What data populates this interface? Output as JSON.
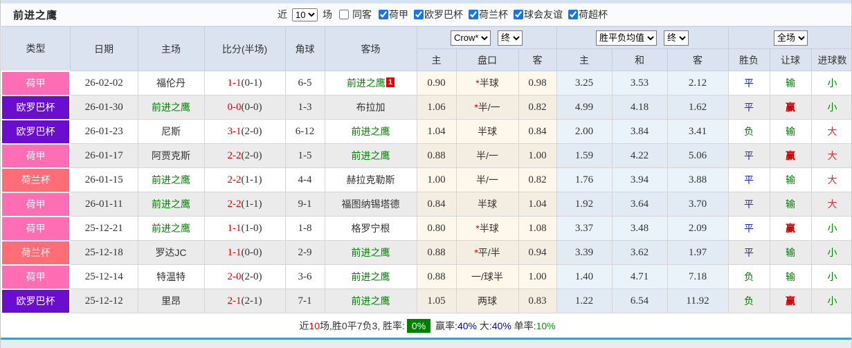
{
  "title": "前进之鹰",
  "filter_bar": {
    "recent_label": "近",
    "recent_value": "10",
    "games_label": "场",
    "same_away": {
      "label": "同客",
      "checked": false
    },
    "competitions": [
      {
        "label": "荷甲",
        "checked": true
      },
      {
        "label": "欧罗巴杯",
        "checked": true
      },
      {
        "label": "荷兰杯",
        "checked": true
      },
      {
        "label": "球会友谊",
        "checked": true
      },
      {
        "label": "荷超杯",
        "checked": true
      }
    ]
  },
  "table": {
    "static_headers": [
      "类型",
      "日期",
      "主场",
      "比分(半场)",
      "角球",
      "客场"
    ],
    "selects": {
      "odds_company": "Crow*",
      "odds_time_1": "终",
      "avg_type": "胜平负均值",
      "odds_time_2": "终",
      "scope": "全场"
    },
    "sub_headers": [
      "主",
      "盘口",
      "客",
      "主",
      "和",
      "客",
      "胜负",
      "让球",
      "进球数"
    ],
    "rows": [
      {
        "comp": "荷甲",
        "date": "26-02-02",
        "home": "福伦丹",
        "home_team": false,
        "score": "1-1",
        "half": "(0-1)",
        "corners": "6-5",
        "away": "前进之鹰",
        "away_team": true,
        "away_badge": "1",
        "odds_home": "0.90",
        "hcap_star": true,
        "handicap": "半球",
        "odds_away": "0.98",
        "avg_home": "3.25",
        "avg_draw": "3.53",
        "avg_away": "2.12",
        "result": "平",
        "hcap_result": "输",
        "goal_result": "小"
      },
      {
        "comp": "欧罗巴杯",
        "date": "26-01-30",
        "home": "前进之鹰",
        "home_team": true,
        "score": "0-0",
        "half": "(0-0)",
        "corners": "1-3",
        "away": "布拉加",
        "away_team": false,
        "away_badge": "",
        "odds_home": "1.06",
        "hcap_star": true,
        "handicap": "半/一",
        "odds_away": "0.82",
        "avg_home": "4.99",
        "avg_draw": "4.18",
        "avg_away": "1.62",
        "result": "平",
        "hcap_result": "赢",
        "goal_result": "小"
      },
      {
        "comp": "欧罗巴杯",
        "date": "26-01-23",
        "home": "尼斯",
        "home_team": false,
        "score": "3-1",
        "half": "(2-0)",
        "corners": "6-12",
        "away": "前进之鹰",
        "away_team": true,
        "away_badge": "",
        "odds_home": "1.04",
        "hcap_star": false,
        "handicap": "半球",
        "odds_away": "0.84",
        "avg_home": "2.00",
        "avg_draw": "3.84",
        "avg_away": "3.41",
        "result": "负",
        "hcap_result": "输",
        "goal_result": "大"
      },
      {
        "comp": "荷甲",
        "date": "26-01-17",
        "home": "阿贾克斯",
        "home_team": false,
        "score": "2-2",
        "half": "(2-0)",
        "corners": "1-5",
        "away": "前进之鹰",
        "away_team": true,
        "away_badge": "",
        "odds_home": "0.88",
        "hcap_star": false,
        "handicap": "半/一",
        "odds_away": "1.00",
        "avg_home": "1.59",
        "avg_draw": "4.22",
        "avg_away": "5.06",
        "result": "平",
        "hcap_result": "赢",
        "goal_result": "大"
      },
      {
        "comp": "荷兰杯",
        "date": "26-01-15",
        "home": "前进之鹰",
        "home_team": true,
        "score": "2-2",
        "half": "(1-1)",
        "corners": "4-4",
        "away": "赫拉克勒斯",
        "away_team": false,
        "away_badge": "",
        "odds_home": "1.00",
        "hcap_star": false,
        "handicap": "半/一",
        "odds_away": "0.82",
        "avg_home": "1.76",
        "avg_draw": "3.94",
        "avg_away": "3.88",
        "result": "平",
        "hcap_result": "输",
        "goal_result": "大"
      },
      {
        "comp": "荷甲",
        "date": "26-01-11",
        "home": "前进之鹰",
        "home_team": true,
        "score": "2-2",
        "half": "(1-1)",
        "corners": "9-1",
        "away": "福图纳锡塔德",
        "away_team": false,
        "away_badge": "",
        "odds_home": "0.84",
        "hcap_star": false,
        "handicap": "半球",
        "odds_away": "1.04",
        "avg_home": "1.92",
        "avg_draw": "3.64",
        "avg_away": "3.70",
        "result": "平",
        "hcap_result": "输",
        "goal_result": "大"
      },
      {
        "comp": "荷甲",
        "date": "25-12-21",
        "home": "前进之鹰",
        "home_team": true,
        "score": "1-1",
        "half": "(1-0)",
        "corners": "1-8",
        "away": "格罗宁根",
        "away_team": false,
        "away_badge": "",
        "odds_home": "0.80",
        "hcap_star": true,
        "handicap": "半球",
        "odds_away": "1.08",
        "avg_home": "3.37",
        "avg_draw": "3.48",
        "avg_away": "2.09",
        "result": "平",
        "hcap_result": "赢",
        "goal_result": "小"
      },
      {
        "comp": "荷兰杯",
        "date": "25-12-18",
        "home": "罗达JC",
        "home_team": false,
        "score": "1-1",
        "half": "(0-0)",
        "corners": "2-9",
        "away": "前进之鹰",
        "away_team": true,
        "away_badge": "",
        "odds_home": "0.88",
        "hcap_star": true,
        "handicap": "平/半",
        "odds_away": "0.94",
        "avg_home": "3.39",
        "avg_draw": "3.62",
        "avg_away": "1.97",
        "result": "平",
        "hcap_result": "输",
        "goal_result": "小"
      },
      {
        "comp": "荷甲",
        "date": "25-12-14",
        "home": "特温特",
        "home_team": false,
        "score": "2-0",
        "half": "(2-0)",
        "corners": "3-6",
        "away": "前进之鹰",
        "away_team": true,
        "away_badge": "",
        "odds_home": "0.88",
        "hcap_star": false,
        "handicap": "一/球半",
        "odds_away": "1.00",
        "avg_home": "1.40",
        "avg_draw": "4.71",
        "avg_away": "7.18",
        "result": "负",
        "hcap_result": "输",
        "goal_result": "小"
      },
      {
        "comp": "欧罗巴杯",
        "date": "25-12-12",
        "home": "里昂",
        "home_team": false,
        "score": "2-1",
        "half": "(2-1)",
        "corners": "7-1",
        "away": "前进之鹰",
        "away_team": true,
        "away_badge": "",
        "odds_home": "1.05",
        "hcap_star": false,
        "handicap": "两球",
        "odds_away": "0.83",
        "avg_home": "1.22",
        "avg_draw": "6.54",
        "avg_away": "11.92",
        "result": "负",
        "hcap_result": "赢",
        "goal_result": "小"
      }
    ]
  },
  "summary": {
    "prefix": "近",
    "count": "10",
    "record": "场,胜0平7负3, 胜率:",
    "win_rate": "0%",
    "win_label": "赢率:",
    "win_value": "40%",
    "big_label": "大:",
    "big_value": "40%",
    "single_label": "单率:",
    "single_value": "10%"
  },
  "colors": {
    "competition": {
      "荷甲": "#ff6eb4",
      "欧罗巴杯": "#6a0dd0",
      "荷兰杯": "#ff6e76"
    },
    "result_class": {
      "平": "c-blue",
      "负": "c-green",
      "胜": "c-red",
      "输": "c-green",
      "赢": "c-redbold",
      "小": "c-green",
      "大": "c-red"
    }
  }
}
